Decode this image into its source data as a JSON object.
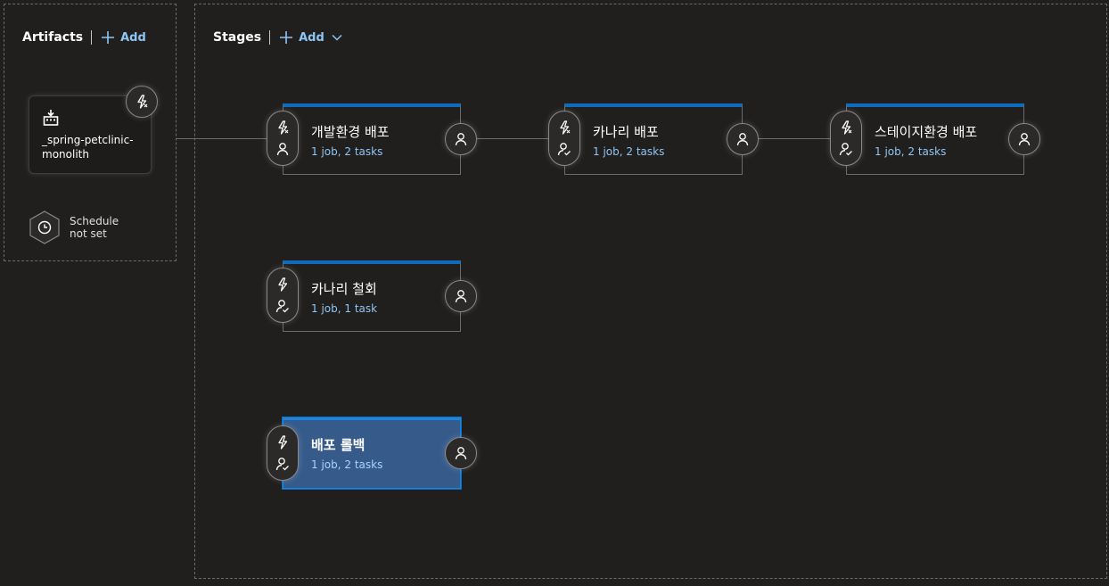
{
  "artifacts": {
    "title": "Artifacts",
    "add_label": "Add",
    "artifact_name": "_spring-petclinic-monolith",
    "schedule_text": "Schedule\nnot set"
  },
  "stages_panel": {
    "title": "Stages",
    "add_label": "Add"
  },
  "stages": [
    {
      "name": "개발환경 배포",
      "summary": "1 job, 2 tasks",
      "selected": false
    },
    {
      "name": "카나리 배포",
      "summary": "1 job, 2 tasks",
      "selected": false
    },
    {
      "name": "스테이지환경 배포",
      "summary": "1 job, 2 tasks",
      "selected": false
    },
    {
      "name": "카나리 철회",
      "summary": "1 job, 1 task",
      "selected": false
    },
    {
      "name": "배포 롤백",
      "summary": "1 job, 2 tasks",
      "selected": true
    }
  ],
  "icons": {
    "add": "plus-icon",
    "chevron": "chevron-down-icon",
    "trigger": "lightning-icon",
    "approver": "person-icon",
    "gate": "person-check-icon",
    "artifact": "build-artifact-icon",
    "schedule": "clock-icon"
  },
  "colors": {
    "background": "#201f1e",
    "accent": "#0f6cbd",
    "link": "#8ec5f5",
    "selected_stage": "#365b8b"
  }
}
